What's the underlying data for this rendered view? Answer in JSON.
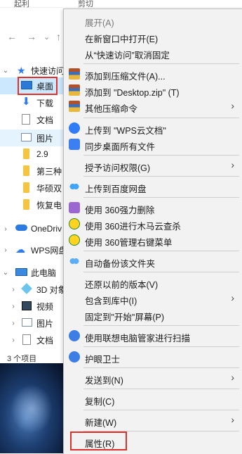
{
  "topbar": {
    "left_fragment": "起利",
    "right_fragment": "剪切"
  },
  "nav": {
    "back": "←",
    "forward": "→",
    "up": "↑"
  },
  "tree": {
    "quick_access": "快速访问",
    "desktop": "桌面",
    "downloads": "下载",
    "documents": "文档",
    "pictures": "图片",
    "folder1": "2.9",
    "folder2": "第三种",
    "folder3": "华硕双",
    "folder4": "恢复电",
    "onedrive": "OneDriv",
    "wps": "WPS网盘",
    "this_pc": "此电脑",
    "objects3d": "3D 对象",
    "videos": "视频",
    "pc_pictures": "图片",
    "pc_documents": "文档"
  },
  "status_bar": {
    "item_count": "3 个项目"
  },
  "context_menu": {
    "items": [
      {
        "label": "展开(A)",
        "disabled": true
      },
      {
        "label": "在新窗口中打开(E)"
      },
      {
        "label": "从“快速访问”取消固定"
      },
      {
        "label": "添加到压缩文件(A)...",
        "icon": "winrar-icon"
      },
      {
        "label": "添加到 \"Desktop.zip\" (T)",
        "icon": "winrar-icon"
      },
      {
        "label": "其他压缩命令",
        "icon": "winrar-icon",
        "submenu": true
      },
      {
        "label": "上传到 \"WPS云文档\"",
        "icon": "wps-cloud-upload-icon"
      },
      {
        "label": "同步桌面所有文件",
        "icon": "sync-icon"
      },
      {
        "label": "授予访问权限(G)",
        "submenu": true
      },
      {
        "label": "上传到百度网盘",
        "icon": "baidu-netdisk-icon"
      },
      {
        "label": "使用 360强力删除",
        "icon": "360-shred-icon"
      },
      {
        "label": "使用 360进行木马云查杀",
        "icon": "360-scan-icon"
      },
      {
        "label": "使用 360管理右键菜单",
        "icon": "360-menu-icon"
      },
      {
        "label": "自动备份该文件夹",
        "icon": "baidu-backup-icon"
      },
      {
        "label": "还原以前的版本(V)"
      },
      {
        "label": "包含到库中(I)",
        "submenu": true
      },
      {
        "label": "固定到\"开始\"屏幕(P)"
      },
      {
        "label": "使用联想电脑管家进行扫描",
        "icon": "lenovo-icon"
      },
      {
        "label": "护眼卫士",
        "icon": "eye-care-icon"
      },
      {
        "label": "发送到(N)",
        "submenu": true
      },
      {
        "label": "复制(C)"
      },
      {
        "label": "新建(W)",
        "submenu": true
      },
      {
        "label": "属性(R)"
      }
    ],
    "submenu_arrow": "›"
  }
}
